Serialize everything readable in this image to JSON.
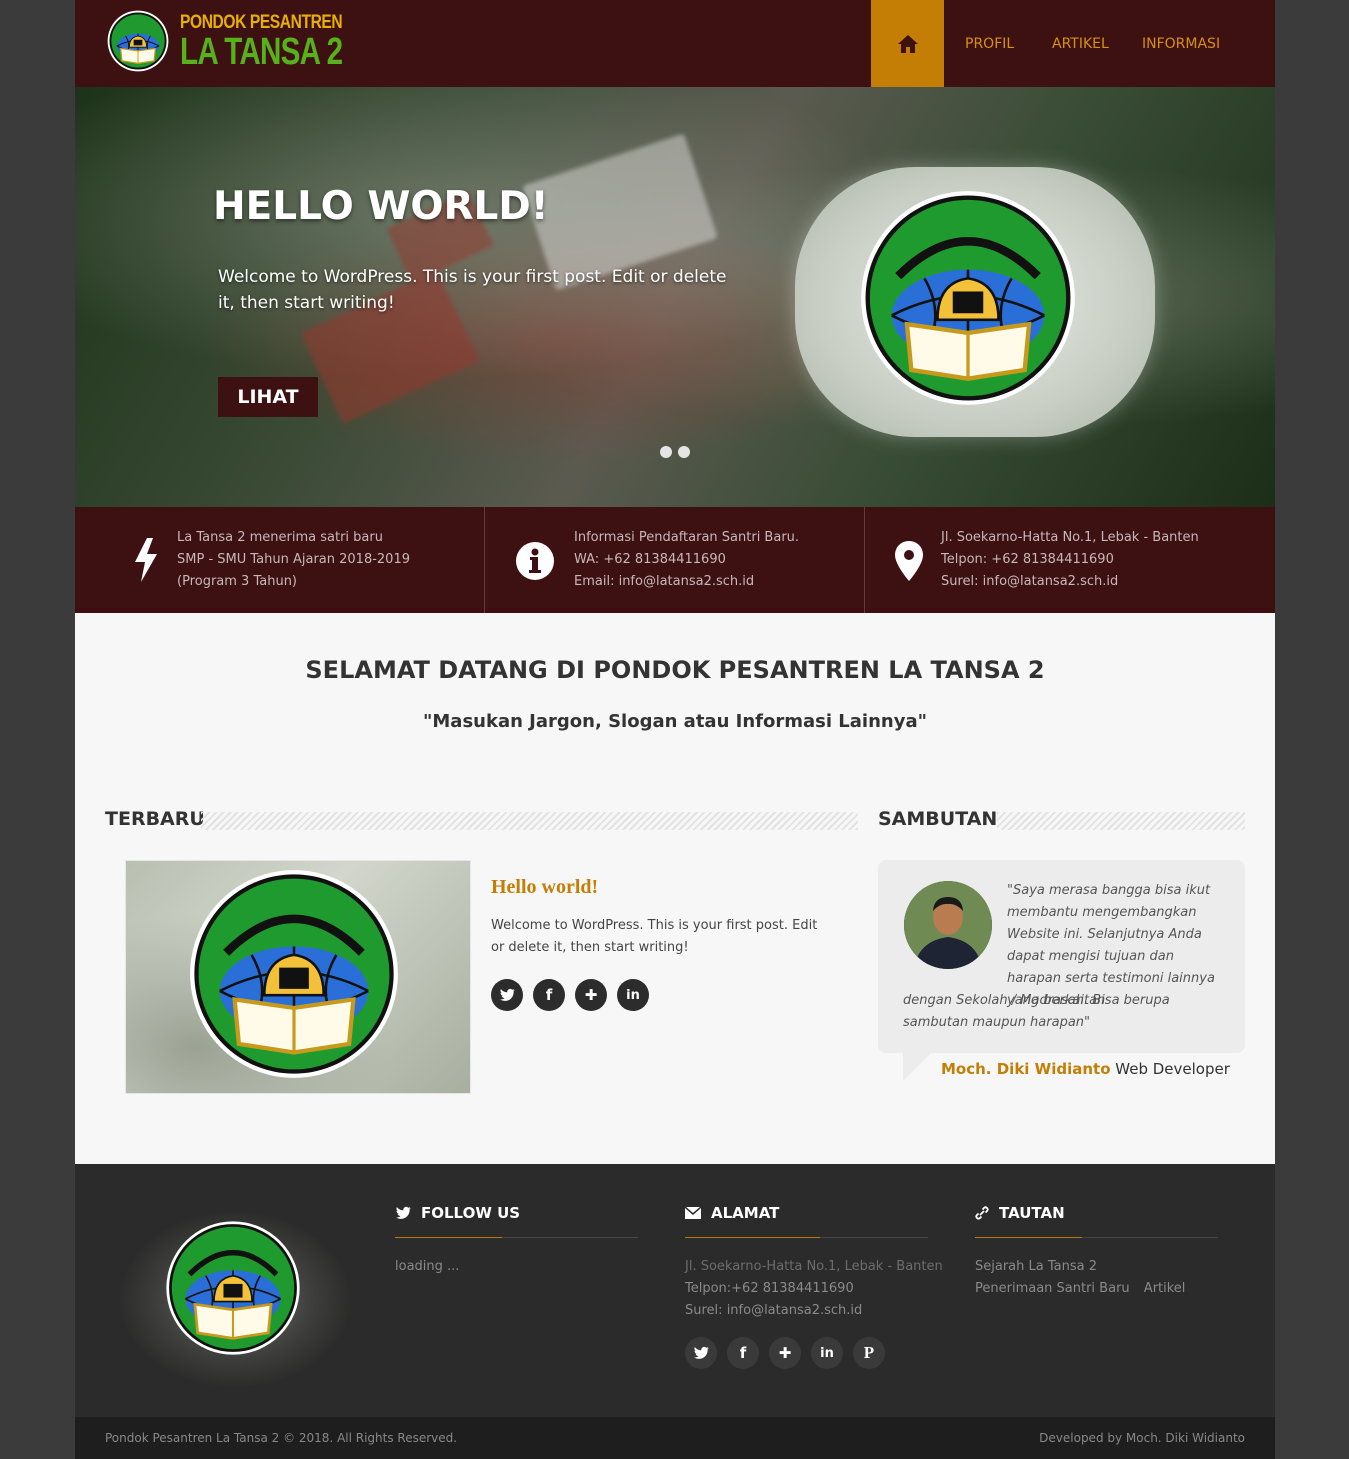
{
  "brand": {
    "top": "PONDOK PESANTREN",
    "main": "LA TANSA 2"
  },
  "nav": {
    "home_icon": "home-icon",
    "items": [
      "PROFIL",
      "ARTIKEL",
      "INFORMASI"
    ]
  },
  "hero": {
    "title": "HELLO WORLD!",
    "text": "Welcome to WordPress. This is your first post. Edit or delete it, then start writing!",
    "button": "LIHAT",
    "slides": 2
  },
  "info": [
    {
      "icon": "bolt-icon",
      "lines": [
        "La Tansa 2 menerima satri baru",
        "SMP - SMU Tahun Ajaran 2018-2019",
        "(Program 3 Tahun)"
      ]
    },
    {
      "icon": "info-icon",
      "lines": [
        "Informasi Pendaftaran Santri Baru.",
        "WA: +62 81384411690",
        "Email: info@latansa2.sch.id"
      ]
    },
    {
      "icon": "map-marker-icon",
      "lines": [
        "Jl. Soekarno-Hatta No.1, Lebak - Banten",
        "Telpon: +62 81384411690",
        "Surel: info@latansa2.sch.id"
      ]
    }
  ],
  "welcome": {
    "title": "SELAMAT DATANG DI PONDOK PESANTREN LA TANSA 2",
    "subtitle": "\"Masukan Jargon, Slogan atau Informasi Lainnya\""
  },
  "latest": {
    "heading": "TERBARU",
    "post_title": "Hello world!",
    "post_text": "Welcome to WordPress. This is your first post. Edit or delete it, then start writing!",
    "share": [
      "twitter-icon",
      "facebook-icon",
      "google-plus-icon",
      "linkedin-icon"
    ]
  },
  "sambutan": {
    "heading": "SAMBUTAN",
    "quote_part1": "\"Saya merasa bangga bisa ikut membantu mengembangkan Website ini. Selanjutnya Anda dapat mengisi tujuan dan harapan serta testimoni lainnya yang berkaitan",
    "quote_part2": "dengan Sekolah / Madrasah. Bisa berupa sambutan maupun harapan\"",
    "name": "Moch. Diki Widianto",
    "role": "Web Developer"
  },
  "footer": {
    "follow": {
      "heading": "FOLLOW US",
      "text": "loading ..."
    },
    "alamat": {
      "heading": "ALAMAT",
      "line1": "Jl. Soekarno-Hatta No.1, Lebak - Banten",
      "line2": "Telpon:+62 81384411690",
      "line3_label": "Surel: ",
      "line3_value": "info@latansa2.sch.id",
      "social": [
        "twitter-icon",
        "facebook-icon",
        "google-plus-icon",
        "linkedin-icon",
        "pinterest-icon"
      ]
    },
    "tautan": {
      "heading": "TAUTAN",
      "links": [
        "Sejarah La Tansa 2",
        "Penerimaan Santri Baru",
        "Artikel"
      ]
    },
    "copyright": "Pondok Pesantren La Tansa 2 © 2018. All Rights Reserved.",
    "developer": "Developed by Moch. Diki Widianto"
  },
  "colors": {
    "maroon": "#3d1111",
    "gold": "#c47e05",
    "emblem_green": "#1f9a2e",
    "emblem_blue": "#2a6fd8"
  }
}
